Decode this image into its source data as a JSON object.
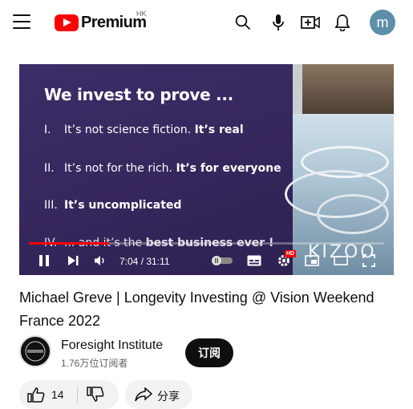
{
  "header": {
    "brand": "Premium",
    "region": "HK",
    "avatar_letter": "m",
    "icons": [
      "menu-icon",
      "search-icon",
      "mic-icon",
      "create-icon",
      "bell-icon"
    ]
  },
  "video": {
    "slide": {
      "title": "We invest to prove ...",
      "points": [
        {
          "num": "I.",
          "text": "It’s not science fiction. ",
          "strong": "It’s real"
        },
        {
          "num": "II.",
          "text": "It’s not for the rich. ",
          "strong": "It’s for everyone"
        },
        {
          "num": "III.",
          "text": "",
          "strong": "It’s uncomplicated"
        },
        {
          "num": "IV.",
          "text": "... and it’s the ",
          "strong": "best business ever !"
        }
      ]
    },
    "watermark": "KIZOO",
    "time": "7:04 / 31:11",
    "progress": 0.226,
    "hd_badge": "HD"
  },
  "title": "Michael Greve | Longevity Investing @ Vision Weekend France 2022",
  "channel": {
    "name": "Foresight Institute",
    "subscribers": "1.76万位订阅者",
    "subscribe_label": "订阅"
  },
  "actions": {
    "likes": "14",
    "share_label": "分享"
  }
}
